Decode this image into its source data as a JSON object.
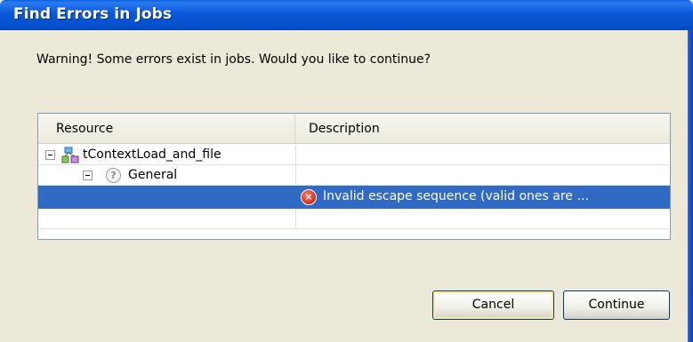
{
  "window": {
    "title": "Find Errors in Jobs"
  },
  "message": "Warning! Some errors exist in jobs. Would you like to continue?",
  "table": {
    "columns": [
      "Resource",
      "Description"
    ],
    "rows": [
      {
        "resource": "tContextLoad_and_file",
        "icon": "job-icon",
        "description": ""
      },
      {
        "resource": "General",
        "icon": "help-icon",
        "description": ""
      },
      {
        "resource": "",
        "icon": "error-icon",
        "description": "Invalid escape sequence (valid ones are  …",
        "selected": true
      }
    ]
  },
  "buttons": {
    "cancel": "Cancel",
    "continue": "Continue"
  },
  "colors": {
    "title_bar": "#0A58D8",
    "selection": "#316AC5",
    "dialog_bg": "#ECE9D8"
  }
}
